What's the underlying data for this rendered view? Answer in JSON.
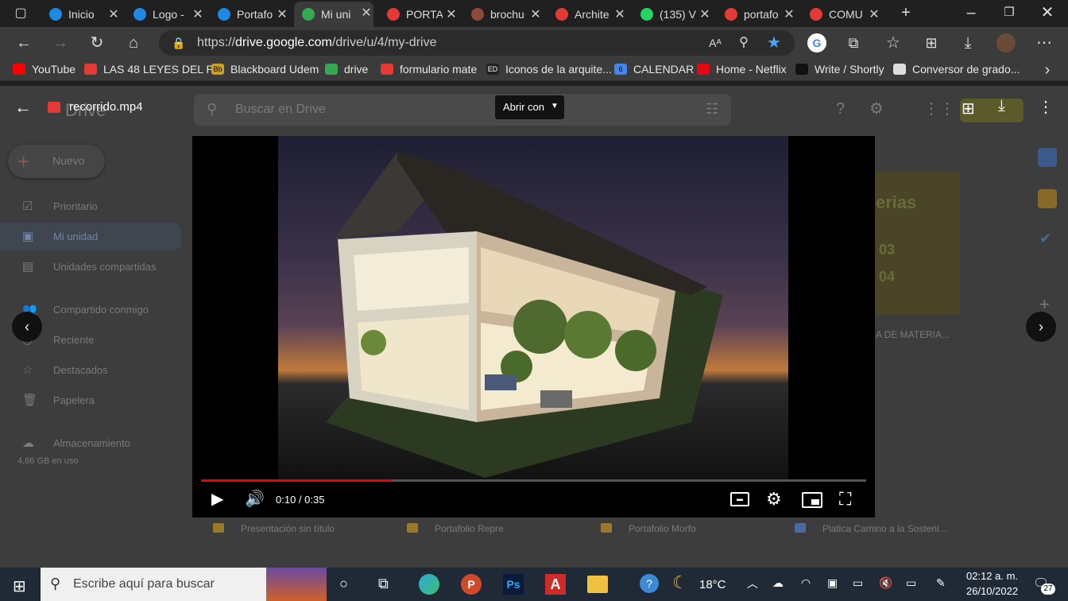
{
  "tabs": [
    {
      "title": "Inicio",
      "color": "#1e88e5"
    },
    {
      "title": "Logo -",
      "color": "#1e88e5"
    },
    {
      "title": "Portafo",
      "color": "#1e88e5"
    },
    {
      "title": "Mi uni",
      "color": "#34a853"
    },
    {
      "title": "PORTA",
      "color": "#e53935"
    },
    {
      "title": "brochu",
      "color": "#8d4a3a"
    },
    {
      "title": "Archite",
      "color": "#e53935"
    },
    {
      "title": "(135) V",
      "color": "#25d366"
    },
    {
      "title": "portafo",
      "color": "#e53935"
    },
    {
      "title": "COMU",
      "color": "#e53935"
    }
  ],
  "new_tab": "+",
  "url": {
    "prefix": "https://",
    "host": "drive.google.com",
    "path": "/drive/u/4/my-drive"
  },
  "bookmarks": [
    {
      "label": "YouTube",
      "icon": "youtube-icon",
      "color": "#ff0000"
    },
    {
      "label": "LAS 48 LEYES DEL P...",
      "icon": "pdf-icon",
      "color": "#e53935"
    },
    {
      "label": "Blackboard Udem",
      "icon": "bb-icon",
      "color": "#c9a227",
      "badge": "Bb"
    },
    {
      "label": "drive",
      "icon": "drive-icon",
      "color": "#34a853"
    },
    {
      "label": "formulario mate",
      "icon": "pdf-icon",
      "color": "#e53935"
    },
    {
      "label": "Iconos de la arquite...",
      "icon": "ed-icon",
      "color": "#222",
      "badge": "ED"
    },
    {
      "label": "CALENDAR",
      "icon": "calendar-icon",
      "color": "#4285f4",
      "badge": "6"
    },
    {
      "label": "Home - Netflix",
      "icon": "netflix-icon",
      "color": "#e50914"
    },
    {
      "label": "Write / Shortly",
      "icon": "shortly-icon",
      "color": "#111"
    },
    {
      "label": "Conversor de grado...",
      "icon": "wordpress-icon",
      "color": "#ddd"
    }
  ],
  "drive": {
    "logo": "Drive",
    "search_placeholder": "Buscar en Drive",
    "new_button": "Nuevo",
    "nav": [
      "Prioritario",
      "Mi unidad",
      "Unidades compartidas",
      "Compartido conmigo",
      "Reciente",
      "Destacados",
      "Papelera",
      "Almacenamiento"
    ],
    "storage": "4,66 GB en uso",
    "files": [
      "Presentación sin título",
      "Portafolio Repre",
      "Portafolio Morfo",
      "Platica Camino a la Sosteni..."
    ],
    "side_file": "A DE MATERIA..."
  },
  "viewer": {
    "filename": "recorrido.mp4",
    "open_with": "Abrir con",
    "time": "0:10 / 0:35",
    "progress": 0.287
  },
  "taskbar": {
    "search_placeholder": "Escribe aquí para buscar",
    "temperature": "18°C",
    "time": "02:12 a. m.",
    "date": "26/10/2022",
    "notifications": "27"
  }
}
